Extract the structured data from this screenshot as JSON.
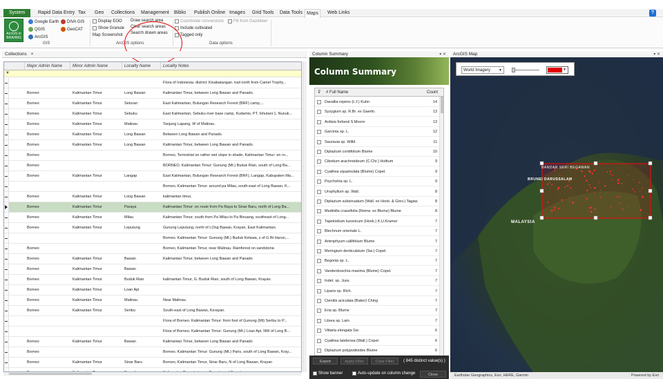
{
  "menu": {
    "items": [
      "System",
      "Rapid Data Entry",
      "Tax",
      "Geo",
      "Collections",
      "Management",
      "Biblio",
      "Publish Online",
      "Images",
      "Grid Tools",
      "Data Tools",
      "Maps",
      "Web Links"
    ],
    "active": "Maps",
    "help_label": "?"
  },
  "ribbon": {
    "arcgis_button": "ArcGIS in BRAHMS",
    "google_earth": "Google Earth",
    "qgis": "QGIS",
    "arcgis": "ArcGIS",
    "diva_gis": "DIVA GIS",
    "geocat": "GeoCAT",
    "gis_group": "GIS",
    "display_eoo": "Display EOO",
    "show_granule": "Show Granule",
    "map_screenshot": "Map Screenshot",
    "draw_search_area": "Draw search area",
    "clear_search_areas": "Clear search areas",
    "search_drawn_areas": "Search drawn areas",
    "arcgis_options_group": "ArcGIS options",
    "coordinate_conversions": "Coordinate conversions",
    "fill_from_gazetteer": "Fill from Gazetteer",
    "include_cultivated": "Include cultivated",
    "tagged_only": "Tagged only",
    "data_options_group": "Data options"
  },
  "collections_pane": {
    "title": "Collections",
    "close": "×",
    "columns": [
      "Major Admin Name",
      "Minor Admin Name",
      "Locality Name",
      "Locality Notes"
    ],
    "rows": [
      {
        "major": "",
        "minor": "",
        "locality": "",
        "notes": "Flora of Indonesia. district: Kinabatangan. trail north from Camel Trophy..."
      },
      {
        "major": "Borneo",
        "minor": "Kalimantan Timur",
        "locality": "Long Bawan",
        "notes": "Kalimantan Timur, between Long Bawan and Panado."
      },
      {
        "major": "Borneo",
        "minor": "Kalimantan Timur",
        "locality": "Seturan",
        "notes": "East Kalimantan, Bulungan Research Forest (BRF) camp,..."
      },
      {
        "major": "Borneo",
        "minor": "Kalimantan Timur",
        "locality": "Sebuku",
        "notes": "East Kalimantan, Sebuku river base camp, Kudamis, PT. Inhutani 1, Nunuk..."
      },
      {
        "major": "Borneo",
        "minor": "Kalimantan Timur",
        "locality": "Malinau",
        "notes": "Tanjung Lapang, W of Malinau."
      },
      {
        "major": "Borneo",
        "minor": "Kalimantan Timur",
        "locality": "Long Bawan",
        "notes": "Between Long Bawan and Panado."
      },
      {
        "major": "Borneo",
        "minor": "Kalimantan Timur",
        "locality": "Long Bawan",
        "notes": "Kalimantan Timur, between Long Bawan and Panado."
      },
      {
        "major": "Borneo",
        "minor": "",
        "locality": "",
        "notes": "Borneo, Terrestrial on rather wet slope in shade, Kalimantan Timur: en ro..."
      },
      {
        "major": "Borneo",
        "minor": "",
        "locality": "",
        "notes": "BORNEO. Kalimantan Timur: Gunung (Mt.) Buduk Rian, south of Long Ba..."
      },
      {
        "major": "Borneo",
        "minor": "Kalimantan Timur",
        "locality": "Langap",
        "notes": "East Kalimantan, Bulungan Research Forest (BRF), Langap, Kabupaten Ma..."
      },
      {
        "major": "",
        "minor": "",
        "locality": "",
        "notes": "Borneo, Kalimantan Timur: around pa Milau, south-east of Long Bawan, K..."
      },
      {
        "major": "Borneo",
        "minor": "Kalimantan Timur",
        "locality": "Long Bawan",
        "notes": "kalimantan timur,"
      },
      {
        "major": "Borneo",
        "minor": "Kalimantan Timur",
        "locality": "Paraya",
        "notes": "Kalimantan Timur: on route from Pa Raya to Sinar Baru, north of Long Ba..."
      },
      {
        "major": "Borneo",
        "minor": "Kalimantan Timur",
        "locality": "Milau",
        "notes": "Kalimantan Timur; south from Pa Milau to Pa Binuang, southeast of Long..."
      },
      {
        "major": "Borneo",
        "minor": "Kalimantan Timur",
        "locality": "Leputung",
        "notes": "Gunung Leputung, north of LOng Bawan, Krayan, East Kalimantan."
      },
      {
        "major": "",
        "minor": "",
        "locality": "",
        "notes": "Borneo. Kalimantan Timur: Gunung (Mt.) Buduk Kelawa, s of G Bt Harun,..."
      },
      {
        "major": "Borneo",
        "minor": "",
        "locality": "",
        "notes": "Borneo, Kalimantan Timur, near Malinau. Rainforest on sandstone."
      },
      {
        "major": "Borneo",
        "minor": "Kalimantan Timur",
        "locality": "Bawan",
        "notes": "Kalimantan Timur, between Long Bawan and Panado"
      },
      {
        "major": "Borneo",
        "minor": "Kalimantan Timur",
        "locality": "Bawan",
        "notes": ""
      },
      {
        "major": "Borneo",
        "minor": "Kalimantan Timur",
        "locality": "Buduk Rian",
        "notes": "kalimantan Timur, G. Buduk Rian, south of Long Bawan, Krayan."
      },
      {
        "major": "Borneo",
        "minor": "Kalimantan Timur",
        "locality": "Loan Api",
        "notes": ""
      },
      {
        "major": "Borneo",
        "minor": "Kalimantan Timur",
        "locality": "Malinau",
        "notes": "Near Malinau."
      },
      {
        "major": "Borneo",
        "minor": "Kalimantan Timur",
        "locality": "Seribu",
        "notes": "South-east of Long Bawan, Kerayan."
      },
      {
        "major": "",
        "minor": "",
        "locality": "",
        "notes": "Flora of Borneo. Kalimantan Timur: from foot of Gunung (Mt) Seribu to P..."
      },
      {
        "major": "",
        "minor": "",
        "locality": "",
        "notes": "Flora of Borneo. Kalimantan Timur: Gunung (Mt.) Loan Api, NW of Long B..."
      },
      {
        "major": "Borneo",
        "minor": "Kalimantan Timur",
        "locality": "Bawan",
        "notes": "Kalimantan Timur, between Long Bawan and Panado"
      },
      {
        "major": "Borneo",
        "minor": "",
        "locality": "",
        "notes": "Borneo. Kalimantan Timur: Gunung (Mt.) Paris, south of Long Bawan, Kray..."
      },
      {
        "major": "Borneo",
        "minor": "Kalimantan Timur",
        "locality": "Sinar Baru",
        "notes": "Borneo, Kalimantan Timur, Sinar Baru, N of Long Bawan, Krayan"
      },
      {
        "major": "Borneo",
        "minor": "Kalimantan Timur",
        "locality": "Panado",
        "notes": "Kalimantan Timur between Panado and Paradan"
      }
    ],
    "selected_row": 12
  },
  "column_summary": {
    "pane_title": "Column Summary",
    "banner_title": "Column Summary",
    "col_name": "# Full Name",
    "col_count": "Count",
    "rows": [
      {
        "name": "Davallia repens (L.f.) Kuhn",
        "count": "14"
      },
      {
        "name": "Syzygium sp. R.Br. ex Gaertn.",
        "count": "13"
      },
      {
        "name": "Ardisia forbesii S.Moore",
        "count": "13"
      },
      {
        "name": "Garcinia sp. L.",
        "count": "12"
      },
      {
        "name": "Saurauia sp. Willd.",
        "count": "11"
      },
      {
        "name": "Diplazium cordifolium Blume",
        "count": "10"
      },
      {
        "name": "Cibotium arachnoideum (C.Chr.) Holttum",
        "count": "9"
      },
      {
        "name": "Cyathea squamulata (Blume) Copel.",
        "count": "9"
      },
      {
        "name": "Psychotria sp. L.",
        "count": "9"
      },
      {
        "name": "Urophyllum sp. Wall.",
        "count": "8"
      },
      {
        "name": "Diplazium subsinuatum (Wall. ex Hook. & Grev.) Tagaw.",
        "count": "8"
      },
      {
        "name": "Medinilla crassifolia (Reinw. ex Blume) Blume",
        "count": "8"
      },
      {
        "name": "Tapeinidium luzonicum (Hook.) K.U.Kramer",
        "count": "7"
      },
      {
        "name": "Blechnum orientale L.",
        "count": "7"
      },
      {
        "name": "Antrophyum callifolium Blume",
        "count": "7"
      },
      {
        "name": "Meringium denticulatum (Sw.) Copel.",
        "count": "7"
      },
      {
        "name": "Begonia sp. L.",
        "count": "7"
      },
      {
        "name": "Vandenboschia maxima (Blume) Copel.",
        "count": "7"
      },
      {
        "name": "Indet. sp. Juss.",
        "count": "7"
      },
      {
        "name": "Liparis sp. Rich.",
        "count": "7"
      },
      {
        "name": "Ctenitis aciculata (Baker) Ching",
        "count": "7"
      },
      {
        "name": "Eria sp. Blume",
        "count": "7"
      },
      {
        "name": "Litsea sp. Lam.",
        "count": "7"
      },
      {
        "name": "Vittaria elongata Sw.",
        "count": "6"
      },
      {
        "name": "Cyathea latebrosa (Wall.) Copel.",
        "count": "6"
      },
      {
        "name": "Diplazium polypodioides Blume",
        "count": "6"
      }
    ],
    "export_button": "Export",
    "apply_button": "Apply Filter",
    "clear_button": "Clear Filter",
    "distinct_values": "( 845  distinct value(s) )",
    "show_banner": "Show banner",
    "auto_update": "Auto-update on column change",
    "close_button": "Close"
  },
  "map": {
    "pane_title": "ArcGIS Map",
    "basemap": "World Imagery",
    "draw_color": "#e00000",
    "label_brunei": "BANDAR SERI BEGAWAN",
    "label_brunei_country": "BRUNEI DARUSSALAM",
    "label_malaysia": "MALAYSIA",
    "attribution": "Earthstar Geographics, Esri, HERE, Garmin",
    "powered_by": "Powered by Esri"
  }
}
